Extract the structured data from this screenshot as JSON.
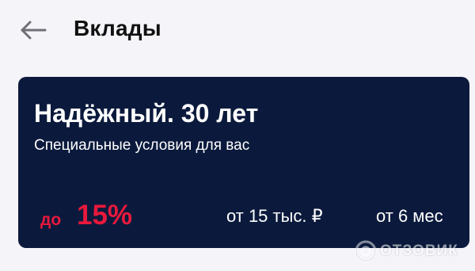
{
  "header": {
    "back_icon": "arrow-left-icon",
    "title": "Вклады"
  },
  "deposit_card": {
    "title": "Надёжный. 30 лет",
    "subtitle": "Специальные условия для вас",
    "rate_prefix": "до",
    "rate_value": "15%",
    "min_amount": "от 15 тыс. ₽",
    "term": "от 6 мес"
  },
  "watermark": {
    "logo_icon": "otzovik-logo-icon",
    "text": "ОТЗОВИК"
  },
  "colors": {
    "background": "#f5f4f9",
    "card": "#0b1a3c",
    "accent": "#e8193c",
    "text_dark": "#111111",
    "text_light": "#ffffff",
    "back_arrow": "#6f6f78"
  }
}
